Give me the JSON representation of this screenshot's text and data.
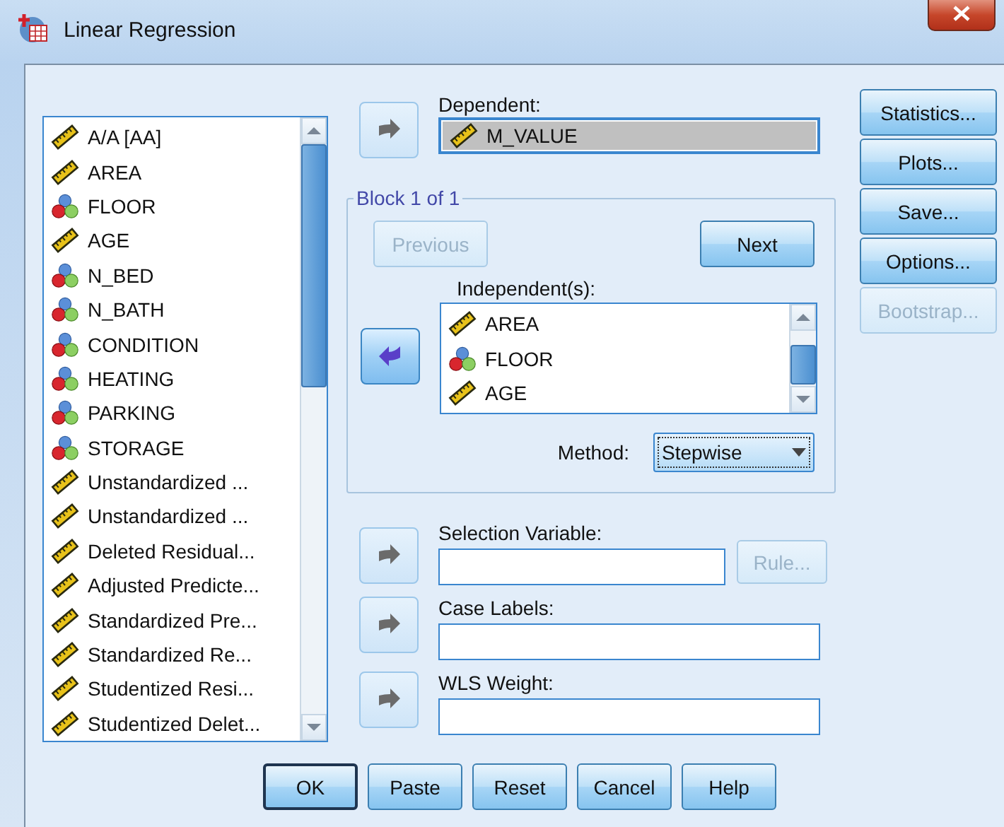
{
  "window": {
    "title": "Linear Regression"
  },
  "variables": [
    {
      "name": "A/A [AA]",
      "kind": "scale"
    },
    {
      "name": "AREA",
      "kind": "scale"
    },
    {
      "name": "FLOOR",
      "kind": "nominal"
    },
    {
      "name": "AGE",
      "kind": "scale"
    },
    {
      "name": "N_BED",
      "kind": "nominal"
    },
    {
      "name": "N_BATH",
      "kind": "nominal"
    },
    {
      "name": "CONDITION",
      "kind": "nominal"
    },
    {
      "name": "HEATING",
      "kind": "nominal"
    },
    {
      "name": "PARKING",
      "kind": "nominal"
    },
    {
      "name": "STORAGE",
      "kind": "nominal"
    },
    {
      "name": "Unstandardized ...",
      "kind": "scale"
    },
    {
      "name": "Unstandardized ...",
      "kind": "scale"
    },
    {
      "name": "Deleted Residual...",
      "kind": "scale"
    },
    {
      "name": "Adjusted Predicte...",
      "kind": "scale"
    },
    {
      "name": "Standardized Pre...",
      "kind": "scale"
    },
    {
      "name": "Standardized Re...",
      "kind": "scale"
    },
    {
      "name": "Studentized Resi...",
      "kind": "scale"
    },
    {
      "name": "Studentized Delet...",
      "kind": "scale"
    }
  ],
  "dependent": {
    "arrow": {
      "kind": "right",
      "disabled": true
    },
    "label": "Dependent:",
    "value": {
      "name": "M_VALUE",
      "kind": "scale"
    }
  },
  "block": {
    "title": "Block 1 of 1",
    "previous": {
      "label": "Previous",
      "disabled": true
    },
    "next": {
      "label": "Next",
      "disabled": false
    },
    "arrow": {
      "kind": "left",
      "disabled": false
    },
    "independents_label": "Independent(s):",
    "independents": [
      {
        "name": "AREA",
        "kind": "scale"
      },
      {
        "name": "FLOOR",
        "kind": "nominal"
      },
      {
        "name": "AGE",
        "kind": "scale"
      }
    ],
    "method_label": "Method:",
    "method": "Stepwise"
  },
  "selection": {
    "arrow": {
      "kind": "right",
      "disabled": true
    },
    "label": "Selection Variable:",
    "rule": {
      "label": "Rule...",
      "disabled": true
    }
  },
  "case_labels": {
    "arrow": {
      "kind": "right",
      "disabled": true
    },
    "label": "Case Labels:"
  },
  "wls_weight": {
    "arrow": {
      "kind": "right",
      "disabled": true
    },
    "label": "WLS Weight:"
  },
  "side_buttons": [
    {
      "label": "Statistics...",
      "disabled": false
    },
    {
      "label": "Plots...",
      "disabled": false
    },
    {
      "label": "Save...",
      "disabled": false
    },
    {
      "label": "Options...",
      "disabled": false
    },
    {
      "label": "Bootstrap...",
      "disabled": true
    }
  ],
  "buttons": [
    {
      "label": "OK",
      "default": true
    },
    {
      "label": "Paste",
      "default": false
    },
    {
      "label": "Reset",
      "default": false
    },
    {
      "label": "Cancel",
      "default": false
    },
    {
      "label": "Help",
      "default": false
    }
  ]
}
